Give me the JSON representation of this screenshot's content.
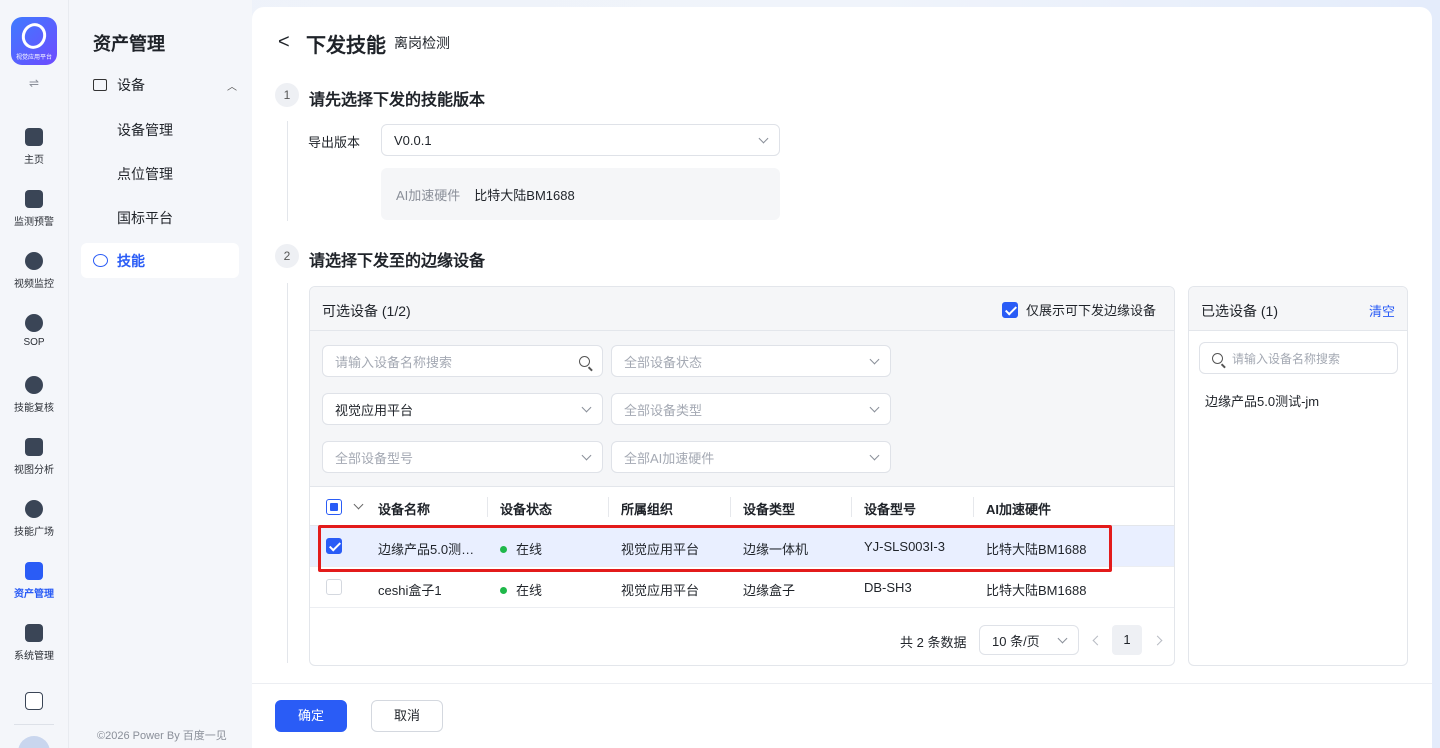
{
  "brand": {
    "logo_caption": "视觉应用平台"
  },
  "rail": {
    "items": [
      {
        "label": "主页",
        "icon": "home-icon"
      },
      {
        "label": "监测预警",
        "icon": "monitor-chart-icon"
      },
      {
        "label": "视频监控",
        "icon": "camera-icon"
      },
      {
        "label": "SOP",
        "icon": "sop-icon"
      },
      {
        "label": "技能复核",
        "icon": "review-icon"
      },
      {
        "label": "视图分析",
        "icon": "view-analysis-icon"
      },
      {
        "label": "技能广场",
        "icon": "skill-square-icon"
      },
      {
        "label": "资产管理",
        "icon": "asset-icon"
      },
      {
        "label": "系统管理",
        "icon": "system-icon"
      }
    ],
    "active_label": "资产管理"
  },
  "sidebar": {
    "title": "资产管理",
    "group": "设备",
    "items": [
      "设备管理",
      "点位管理",
      "国标平台"
    ],
    "active": "技能",
    "footer": "©2026 Power By 百度一见"
  },
  "header": {
    "back_symbol": "<",
    "title": "下发技能",
    "subtitle": "离岗检测"
  },
  "step1": {
    "num": "1",
    "title": "请先选择下发的技能版本",
    "field_label": "导出版本",
    "version_value": "V0.0.1",
    "hw_key": "AI加速硬件",
    "hw_value": "比特大陆BM1688"
  },
  "step2": {
    "num": "2",
    "title": "请选择下发至的边缘设备",
    "available_title": "可选设备 (1/2)",
    "only_dispatchable_label": "仅展示可下发边缘设备",
    "filters": {
      "search_placeholder": "请输入设备名称搜索",
      "status": "全部设备状态",
      "org": "视觉应用平台",
      "type": "全部设备类型",
      "model": "全部设备型号",
      "hw": "全部AI加速硬件"
    },
    "columns": [
      "设备名称",
      "设备状态",
      "所属组织",
      "设备类型",
      "设备型号",
      "AI加速硬件"
    ],
    "rows": [
      {
        "name": "边缘产品5.0测…",
        "status": "在线",
        "org": "视觉应用平台",
        "type": "边缘一体机",
        "model": "YJ-SLS003I-3",
        "hw": "比特大陆BM1688",
        "checked": true
      },
      {
        "name": "ceshi盒子1",
        "status": "在线",
        "org": "视觉应用平台",
        "type": "边缘盒子",
        "model": "DB-SH3",
        "hw": "比特大陆BM1688",
        "checked": false
      }
    ],
    "pagination": {
      "total_text": "共 2 条数据",
      "page_size": "10 条/页",
      "current_page": "1"
    },
    "selected_title": "已选设备 (1)",
    "clear_label": "清空",
    "selected_search_placeholder": "请输入设备名称搜索",
    "selected_items": [
      "边缘产品5.0测试-jm"
    ]
  },
  "footer": {
    "confirm": "确定",
    "cancel": "取消"
  },
  "colors": {
    "primary": "#2a5cf6",
    "online": "#1fb84a",
    "highlight": "#e31b1b"
  }
}
